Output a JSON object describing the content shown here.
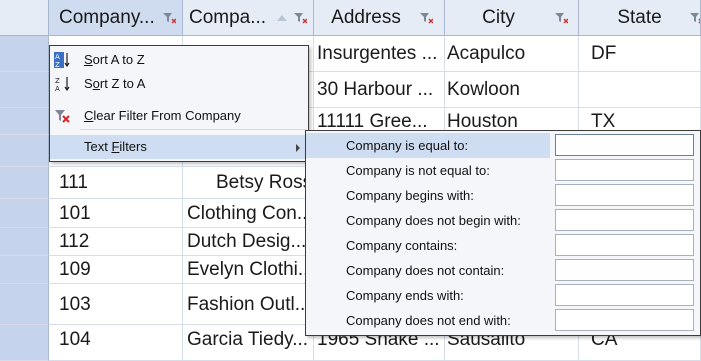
{
  "headers": [
    {
      "label": "Company..."
    },
    {
      "label": "Compa..."
    },
    {
      "label": "Address"
    },
    {
      "label": "City"
    },
    {
      "label": "State"
    }
  ],
  "rows": [
    [
      "",
      "",
      "Insurgentes ...",
      "Acapulco",
      "DF"
    ],
    [
      "",
      "",
      "30 Harbour ...",
      "Kowloon",
      ""
    ],
    [
      "",
      "",
      "11111 Gree...",
      "Houston",
      "TX"
    ],
    [
      "",
      "",
      "",
      "",
      ""
    ],
    [
      "111",
      "Betsy Ross ...",
      "",
      "",
      ""
    ],
    [
      "101",
      "Clothing Con...",
      "",
      "",
      ""
    ],
    [
      "112",
      "Dutch Desig...",
      "",
      "",
      ""
    ],
    [
      "109",
      "Evelyn Clothi...",
      "",
      "",
      ""
    ],
    [
      "103",
      "Fashion Outl...",
      "",
      "",
      ""
    ],
    [
      "104",
      "Garcia Tiedy...",
      "1965 Snake ...",
      "Sausalito",
      "CA"
    ]
  ],
  "context_menu": {
    "items": [
      {
        "pre": "",
        "ul": "S",
        "post": "ort A to Z",
        "icon": "sort-ascending-icon"
      },
      {
        "pre": "S",
        "ul": "o",
        "post": "rt Z to A",
        "icon": "sort-descending-icon"
      },
      {
        "pre": "",
        "ul": "C",
        "post": "lear Filter From Company",
        "icon": "clear-filter-icon"
      },
      {
        "pre": "Text ",
        "ul": "F",
        "post": "ilters",
        "icon": ""
      }
    ]
  },
  "text_filters": {
    "items": [
      {
        "label": "Company is equal to:",
        "value": ""
      },
      {
        "label": "Company is not equal to:",
        "value": ""
      },
      {
        "label": "Company begins with:",
        "value": ""
      },
      {
        "label": "Company does not begin with:",
        "value": ""
      },
      {
        "label": "Company contains:",
        "value": ""
      },
      {
        "label": "Company does not contain:",
        "value": ""
      },
      {
        "label": "Company ends with:",
        "value": ""
      },
      {
        "label": "Company does not end with:",
        "value": ""
      }
    ]
  },
  "colors": {
    "header_bg": "#e6ecf6",
    "row_selector": "#c5d4ec",
    "menu_highlight": "#cfddf2",
    "menu_bg": "#f4f6fa"
  }
}
